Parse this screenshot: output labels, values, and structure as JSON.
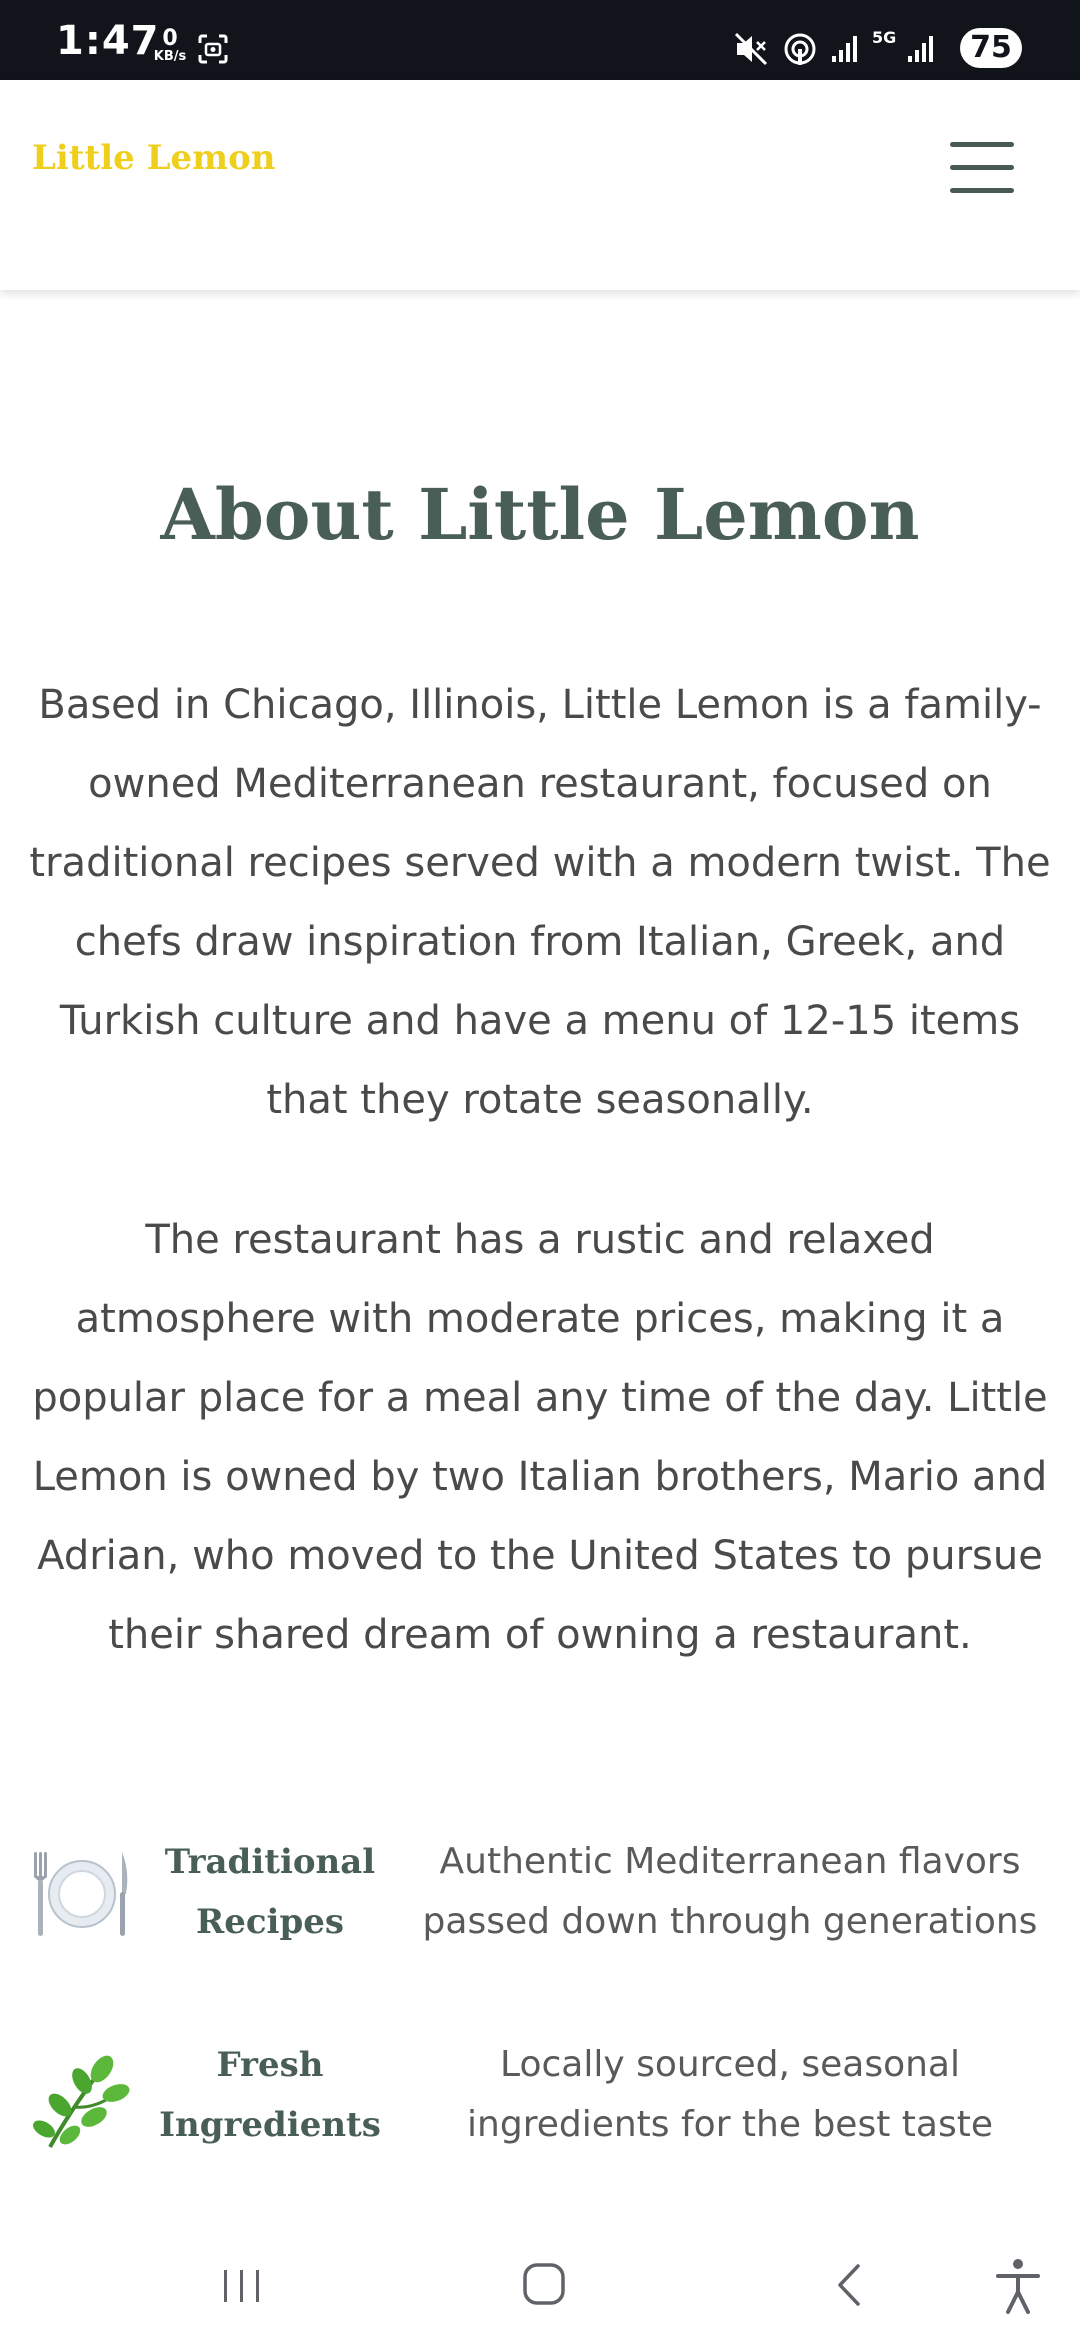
{
  "status_bar": {
    "time": "1:47",
    "net_speed_value": "0",
    "net_speed_unit": "KB/s",
    "network_label": "5G",
    "battery": "75",
    "icons": [
      "screenshot-icon",
      "mute-icon",
      "hotspot-icon",
      "signal-icon",
      "5g-icon",
      "signal-icon"
    ]
  },
  "header": {
    "brand": "Little Lemon",
    "brand_color": "#f0ce1c",
    "menu_icon": "hamburger-icon"
  },
  "about": {
    "title": "About Little Lemon",
    "paragraph1": "Based in Chicago, Illinois, Little Lemon is a family-owned Mediterranean restaurant, focused on traditional recipes served with a modern twist. The chefs draw inspiration from Italian, Greek, and Turkish culture and have a menu of 12-15 items that they rotate seasonally.",
    "paragraph2": "The restaurant has a rustic and relaxed atmosphere with moderate prices, making it a popular place for a meal any time of the day. Little Lemon is owned by two Italian brothers, Mario and Adrian, who moved to the United States to pursue their shared dream of owning a restaurant."
  },
  "features": [
    {
      "icon": "plate-cutlery-icon",
      "title": "Traditional Recipes",
      "description": "Authentic Mediterranean flavors passed down through generations"
    },
    {
      "icon": "herb-icon",
      "title": "Fresh Ingredients",
      "description": "Locally sourced, seasonal ingredients for the best taste"
    }
  ],
  "nav_bar": {
    "buttons": [
      "recent-apps-icon",
      "home-icon",
      "back-icon",
      "accessibility-icon"
    ]
  },
  "colors": {
    "primary_green": "#495e57",
    "status_bar_bg": "#11141a",
    "body_text": "#4a4a4a"
  }
}
